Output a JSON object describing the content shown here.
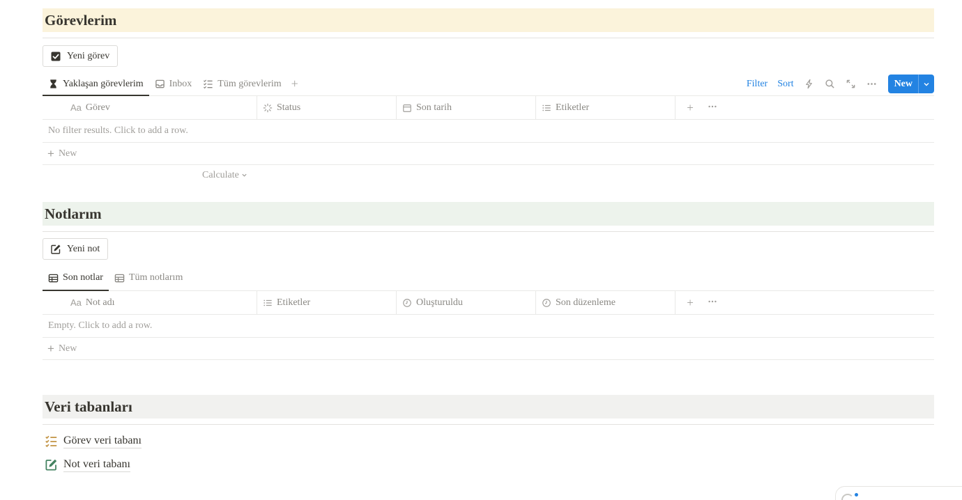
{
  "tasks": {
    "title": "Görevlerim",
    "header_bg": "#fbf3db",
    "new_item_label": "Yeni görev",
    "tabs": [
      {
        "label": "Yaklaşan görevlerim",
        "icon": "hourglass-icon"
      },
      {
        "label": "Inbox",
        "icon": "inbox-icon"
      },
      {
        "label": "Tüm görevlerim",
        "icon": "checklist-icon"
      }
    ],
    "toolbar": {
      "filter": "Filter",
      "sort": "Sort",
      "new": "New"
    },
    "columns": [
      {
        "label": "Görev",
        "icon": "Aa"
      },
      {
        "label": "Status",
        "icon": "status-icon"
      },
      {
        "label": "Son tarih",
        "icon": "calendar-icon"
      },
      {
        "label": "Etiketler",
        "icon": "list-icon"
      }
    ],
    "empty_text": "No filter results. Click to add a row.",
    "new_row_label": "New",
    "calculate_label": "Calculate"
  },
  "notes": {
    "title": "Notlarım",
    "header_bg": "#edf3ec",
    "new_item_label": "Yeni not",
    "tabs": [
      {
        "label": "Son notlar",
        "icon": "table-icon"
      },
      {
        "label": "Tüm notlarım",
        "icon": "table-icon"
      }
    ],
    "columns": [
      {
        "label": "Not adı",
        "icon": "Aa"
      },
      {
        "label": "Etiketler",
        "icon": "list-icon"
      },
      {
        "label": "Oluşturuldu",
        "icon": "clock-icon"
      },
      {
        "label": "Son düzenleme",
        "icon": "clock-icon"
      }
    ],
    "empty_text": "Empty. Click to add a row.",
    "new_row_label": "New"
  },
  "databases": {
    "title": "Veri tabanları",
    "header_bg": "#f1f1ef",
    "links": [
      {
        "label": "Görev veri tabanı",
        "icon": "checklist-icon",
        "color": "#c29343"
      },
      {
        "label": "Not veri tabanı",
        "icon": "edit-icon",
        "color": "#448361"
      }
    ]
  },
  "colors": {
    "accent": "#2383e2",
    "text": "#37352f",
    "muted": "#a09e9a"
  }
}
